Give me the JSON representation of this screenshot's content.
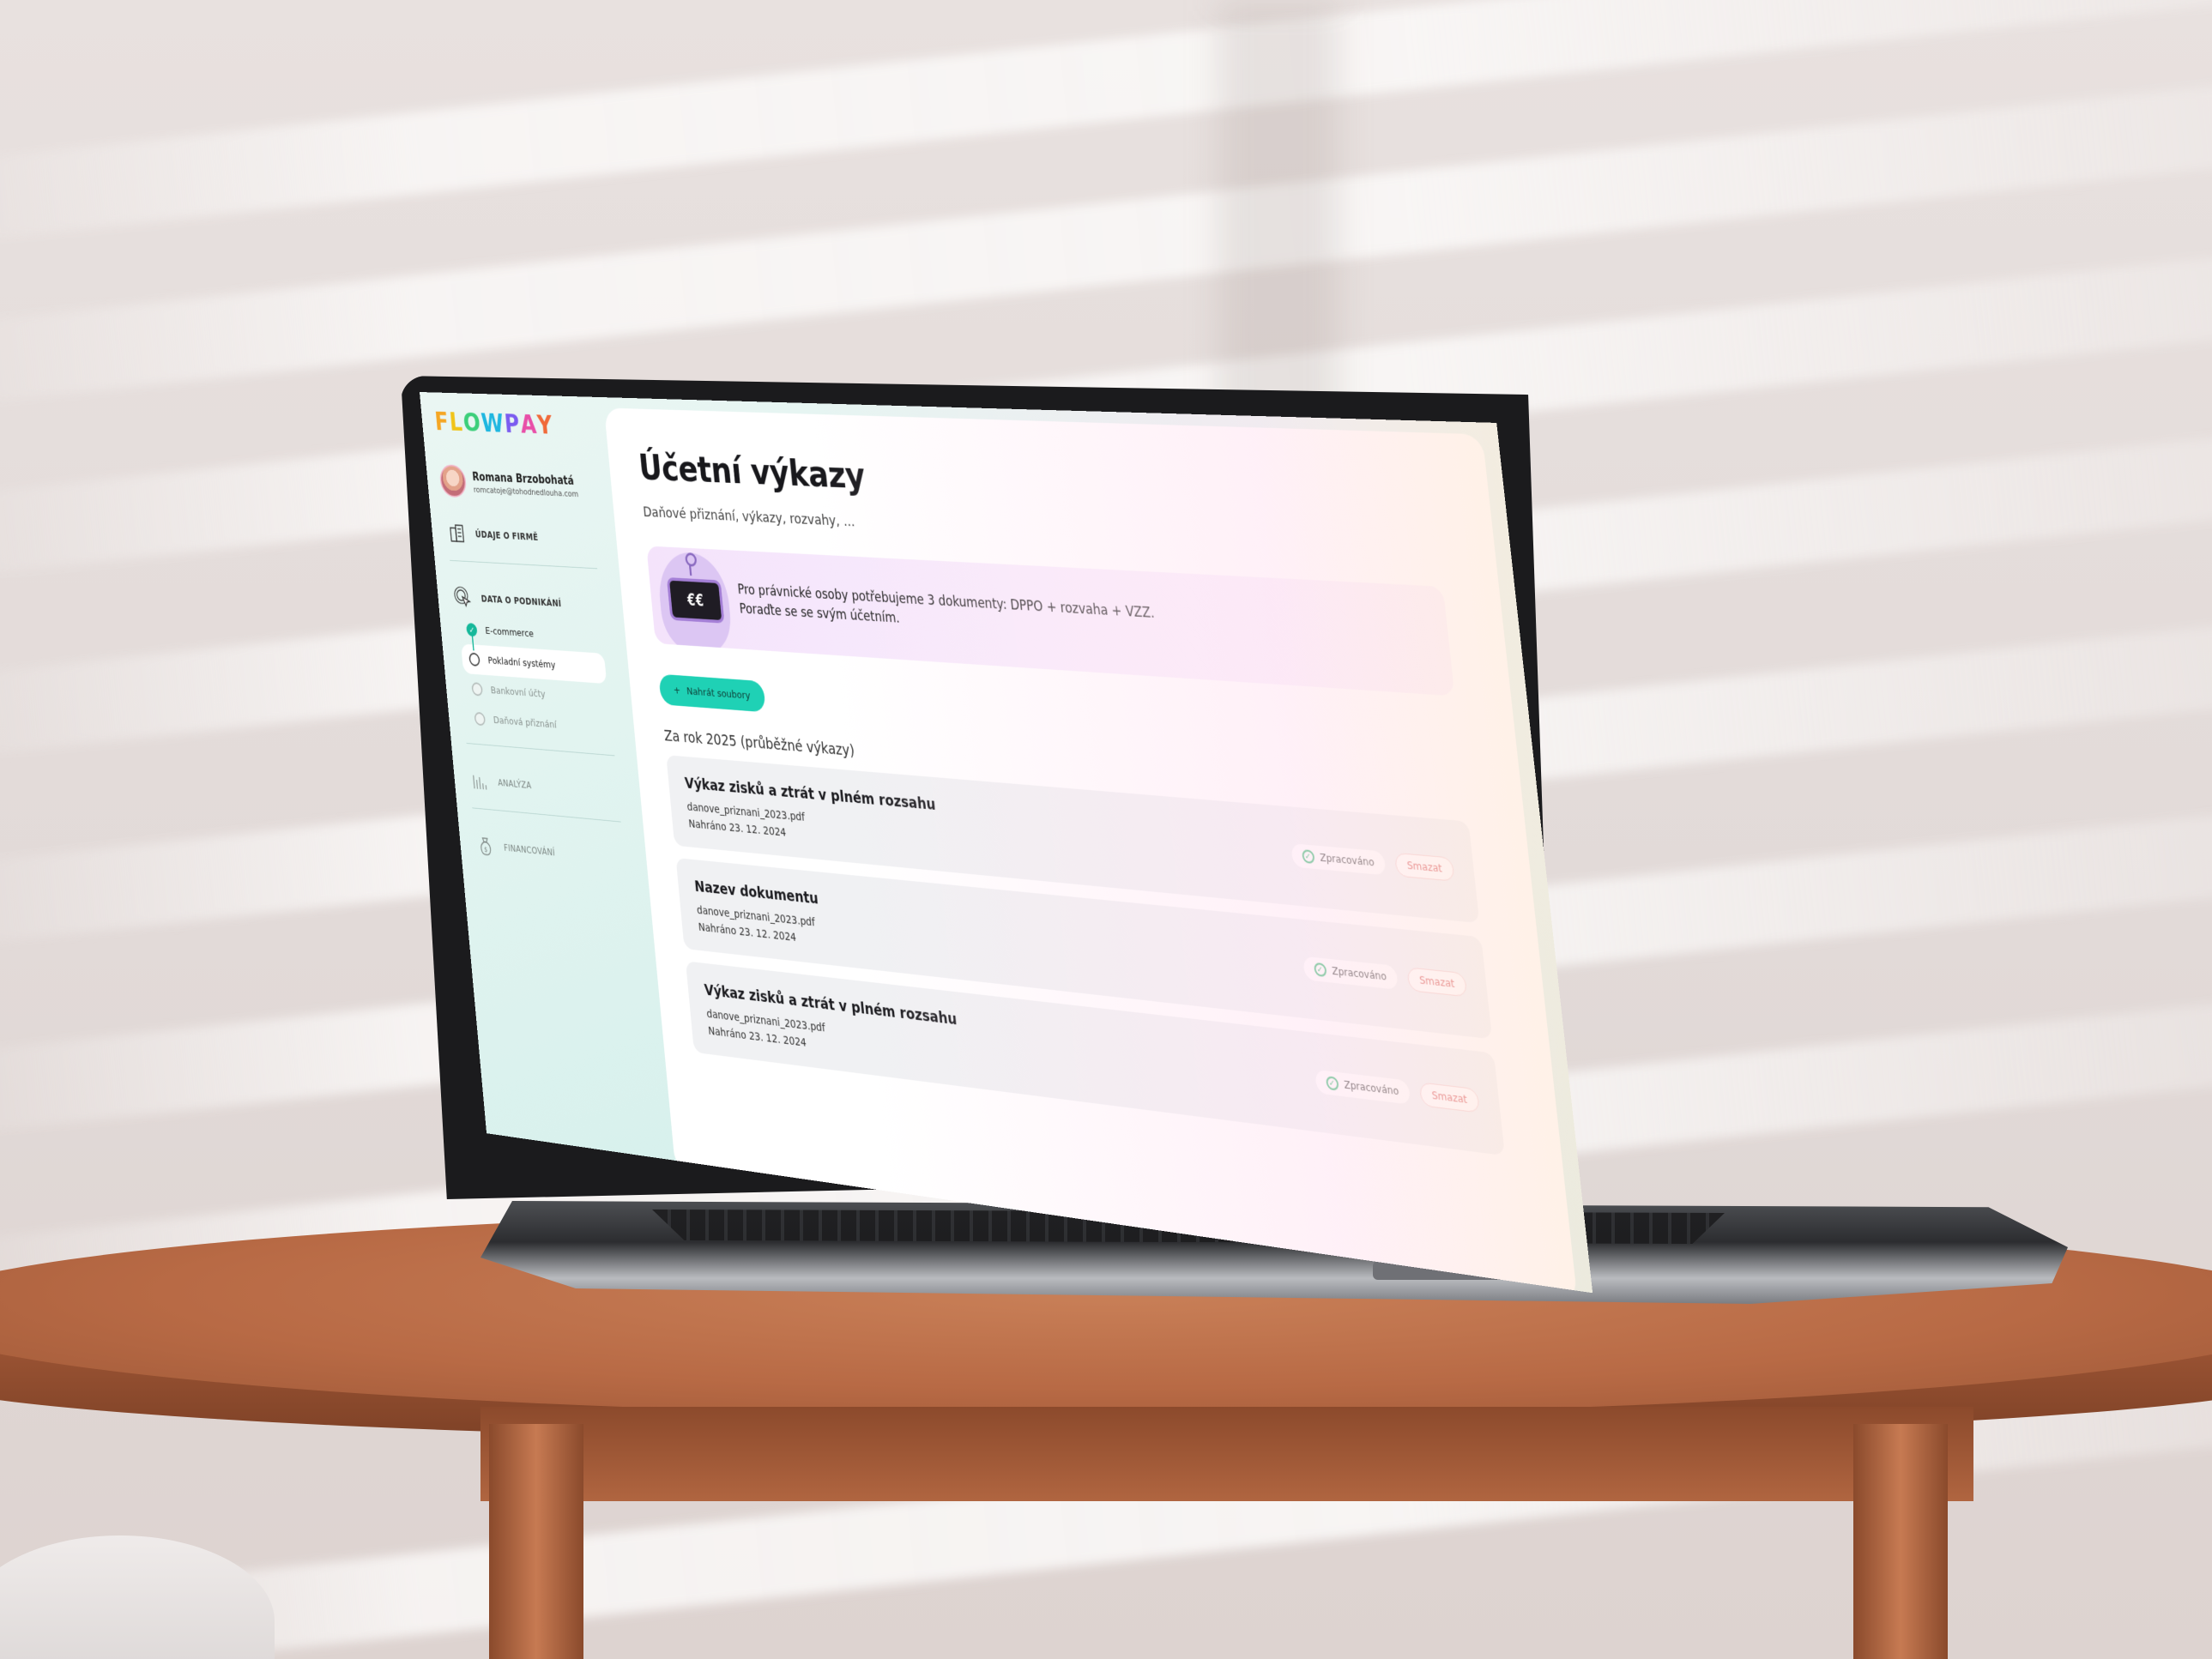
{
  "app": {
    "logo": "FLOWPAY",
    "logo_letters": [
      {
        "char": "F",
        "color": "#f5a623"
      },
      {
        "char": "L",
        "color": "#f0c419"
      },
      {
        "char": "O",
        "color": "#3ccf7a"
      },
      {
        "char": "W",
        "color": "#1fb7e0"
      },
      {
        "char": "P",
        "color": "#7b5cf0"
      },
      {
        "char": "A",
        "color": "#e84fa8"
      },
      {
        "char": "Y",
        "color": "#f06a3a"
      }
    ]
  },
  "user": {
    "name": "Romana Brzobohatá",
    "email": "romcatoje@tohodnedlouha.com"
  },
  "sidebar": {
    "company": {
      "label": "ÚDAJE O FIRMĚ",
      "icon": "building-icon"
    },
    "business_data": {
      "label": "DATA O PODNIKÁNÍ",
      "icon": "cursor-click-icon",
      "items": [
        {
          "label": "E-commerce",
          "state": "done"
        },
        {
          "label": "Pokladní systémy",
          "state": "active"
        },
        {
          "label": "Bankovní účty",
          "state": "muted"
        },
        {
          "label": "Daňová přiznání",
          "state": "muted"
        }
      ]
    },
    "analysis": {
      "label": "ANALÝZA",
      "icon": "bar-chart-icon"
    },
    "financing": {
      "label": "FINANCOVÁNÍ",
      "icon": "money-bag-icon"
    }
  },
  "main": {
    "title": "Účetní výkazy",
    "subtitle": "Daňové přiznání, výkazy, rozvahy, ...",
    "info": {
      "line1": "Pro právnické osoby potřebujeme 3 dokumenty: DPPO + rozvaha + VZZ.",
      "line2": "Poraďte se se svým účetním.",
      "robot_face": "€€"
    },
    "upload_button": "Nahrát soubory",
    "upload_icon": "+",
    "section_title": "Za rok 2025 (průběžné výkazy)",
    "documents": [
      {
        "title": "Výkaz zisků a ztrát v plném rozsahu",
        "file": "danove_priznani_2023.pdf",
        "uploaded": "Nahráno 23. 12. 2024",
        "status": "Zpracováno",
        "delete": "Smazat"
      },
      {
        "title": "Nazev dokumentu",
        "file": "danove_priznani_2023.pdf",
        "uploaded": "Nahráno 23. 12. 2024",
        "status": "Zpracováno",
        "delete": "Smazat"
      },
      {
        "title": "Výkaz zisků a ztrát v plném rozsahu",
        "file": "danove_priznani_2023.pdf",
        "uploaded": "Nahráno 23. 12. 2024",
        "status": "Zpracováno",
        "delete": "Smazat"
      }
    ]
  },
  "colors": {
    "accent": "#1fd1b5",
    "success": "#18b05f",
    "danger": "#d23b3b",
    "info_bg": "#f4e3fb"
  }
}
